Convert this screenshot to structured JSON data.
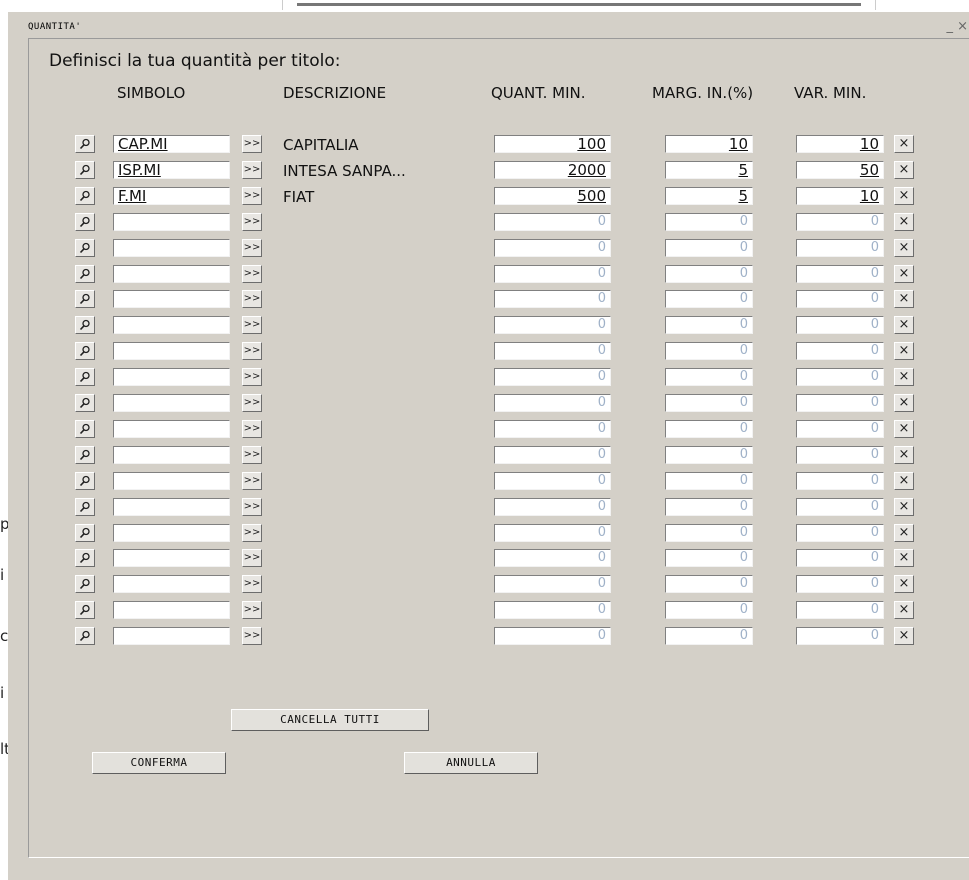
{
  "background_fragments": [
    "p",
    "i",
    "c",
    "i",
    "lt"
  ],
  "window": {
    "title": "QUANTITA'",
    "controls": "_ ×"
  },
  "heading": "Definisci la tua quantità per titolo:",
  "columns": {
    "simbolo": "SIMBOLO",
    "descrizione": "DESCRIZIONE",
    "quant_min": "QUANT. MIN.",
    "marg_in": "MARG. IN.(%)",
    "var_min": "VAR. MIN."
  },
  "icons": {
    "search": "search-icon",
    "go": "double-chevron-right-icon",
    "remove": "close-icon"
  },
  "go_label": ">>",
  "remove_label": "×",
  "rows": [
    {
      "symbol": "CAP.MI",
      "description": "CAPITALIA",
      "quant_min": "100",
      "marg_in": "10",
      "var_min": "10"
    },
    {
      "symbol": "ISP.MI",
      "description": "INTESA SANPA...",
      "quant_min": "2000",
      "marg_in": "5",
      "var_min": "50"
    },
    {
      "symbol": "F.MI",
      "description": "FIAT",
      "quant_min": "500",
      "marg_in": "5",
      "var_min": "10"
    },
    {
      "symbol": "",
      "description": "",
      "quant_min": "0",
      "marg_in": "0",
      "var_min": "0"
    },
    {
      "symbol": "",
      "description": "",
      "quant_min": "0",
      "marg_in": "0",
      "var_min": "0"
    },
    {
      "symbol": "",
      "description": "",
      "quant_min": "0",
      "marg_in": "0",
      "var_min": "0"
    },
    {
      "symbol": "",
      "description": "",
      "quant_min": "0",
      "marg_in": "0",
      "var_min": "0"
    },
    {
      "symbol": "",
      "description": "",
      "quant_min": "0",
      "marg_in": "0",
      "var_min": "0"
    },
    {
      "symbol": "",
      "description": "",
      "quant_min": "0",
      "marg_in": "0",
      "var_min": "0"
    },
    {
      "symbol": "",
      "description": "",
      "quant_min": "0",
      "marg_in": "0",
      "var_min": "0"
    },
    {
      "symbol": "",
      "description": "",
      "quant_min": "0",
      "marg_in": "0",
      "var_min": "0"
    },
    {
      "symbol": "",
      "description": "",
      "quant_min": "0",
      "marg_in": "0",
      "var_min": "0"
    },
    {
      "symbol": "",
      "description": "",
      "quant_min": "0",
      "marg_in": "0",
      "var_min": "0"
    },
    {
      "symbol": "",
      "description": "",
      "quant_min": "0",
      "marg_in": "0",
      "var_min": "0"
    },
    {
      "symbol": "",
      "description": "",
      "quant_min": "0",
      "marg_in": "0",
      "var_min": "0"
    },
    {
      "symbol": "",
      "description": "",
      "quant_min": "0",
      "marg_in": "0",
      "var_min": "0"
    },
    {
      "symbol": "",
      "description": "",
      "quant_min": "0",
      "marg_in": "0",
      "var_min": "0"
    },
    {
      "symbol": "",
      "description": "",
      "quant_min": "0",
      "marg_in": "0",
      "var_min": "0"
    },
    {
      "symbol": "",
      "description": "",
      "quant_min": "0",
      "marg_in": "0",
      "var_min": "0"
    },
    {
      "symbol": "",
      "description": "",
      "quant_min": "0",
      "marg_in": "0",
      "var_min": "0"
    }
  ],
  "buttons": {
    "cancella_tutti": "CANCELLA TUTTI",
    "conferma": "CONFERMA",
    "annulla": "ANNULLA"
  }
}
